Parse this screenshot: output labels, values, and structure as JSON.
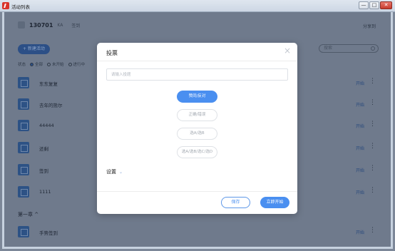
{
  "window": {
    "title": "活动列表",
    "min": "—",
    "max": "□",
    "close": "✕"
  },
  "background": {
    "class_number": "130701",
    "class_sub": "KA",
    "class_tag": "签到",
    "share": "分享到",
    "new_activity": "+ 新建活动",
    "search_placeholder": "搜索",
    "filter": {
      "label": "状态",
      "options": [
        "全部",
        "未开始",
        "进行中"
      ]
    },
    "activities": [
      {
        "name": "东东复复",
        "action": "开始"
      },
      {
        "name": "去年的熊尔",
        "action": "开始"
      },
      {
        "name": "44444",
        "action": "开始"
      },
      {
        "name": "还剩",
        "action": "开始"
      },
      {
        "name": "签到",
        "action": "开始"
      },
      {
        "name": "1111",
        "action": "开始"
      },
      {
        "name": "手势签到",
        "action": "开始"
      }
    ],
    "chapter": "第一章 ^"
  },
  "modal": {
    "title": "投票",
    "close": "×",
    "input_placeholder": "请输入投题",
    "options": [
      "赞同/反对",
      "正确/错误",
      "选A/选B",
      "选A/选B/选C/选D"
    ],
    "selected_index": 0,
    "settings": "设置",
    "save": "保存",
    "start": "立即开始"
  },
  "colors": {
    "accent": "#4a8ff0",
    "overlay": "#6f7a8c"
  }
}
